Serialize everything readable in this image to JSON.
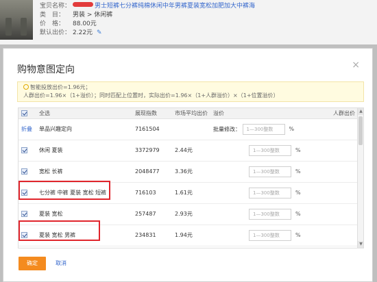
{
  "product": {
    "title_label": "宝贝名称：",
    "title_value": "男士短裤七分裤纯棉休闲中年男裤夏装宽松加肥加大中裤海",
    "category_label": "类　目：",
    "category_value": "男装 > 休闲裤",
    "price_label": "价　格：",
    "price_value": "88.00元",
    "default_bid_label": "默认出价：",
    "default_bid_value": "2.22元"
  },
  "dialog": {
    "title": "购物意图定向",
    "close": "×",
    "tip_line1": "智能投放出价=1.96元；",
    "tip_line2": "人群出价=1.96×（1+溢价）；同时匹配上位置时，实际出价=1.96×（1+人群溢价）×（1+位置溢价）",
    "columns": [
      "全选",
      "展现指数",
      "市场平均出价",
      "溢价",
      "人群出价"
    ],
    "batch_label": "批量修改：",
    "input_placeholder": "1—300整数",
    "pct": "%",
    "fold": "折叠",
    "ok": "确定",
    "cancel": "取消",
    "rows": [
      {
        "name": "单品兴趣定向",
        "index": "7161504",
        "avg": ""
      },
      {
        "name": "休闲 夏装",
        "index": "3372979",
        "avg": "2.44元"
      },
      {
        "name": "宽松 长裤",
        "index": "2048477",
        "avg": "3.36元"
      },
      {
        "name": "七分裤 中裤 夏装 宽松 短裤",
        "index": "716103",
        "avg": "1.61元"
      },
      {
        "name": "夏装 宽松",
        "index": "257487",
        "avg": "2.93元"
      },
      {
        "name": "夏装 宽松 男裤",
        "index": "234831",
        "avg": "1.94元"
      }
    ]
  }
}
